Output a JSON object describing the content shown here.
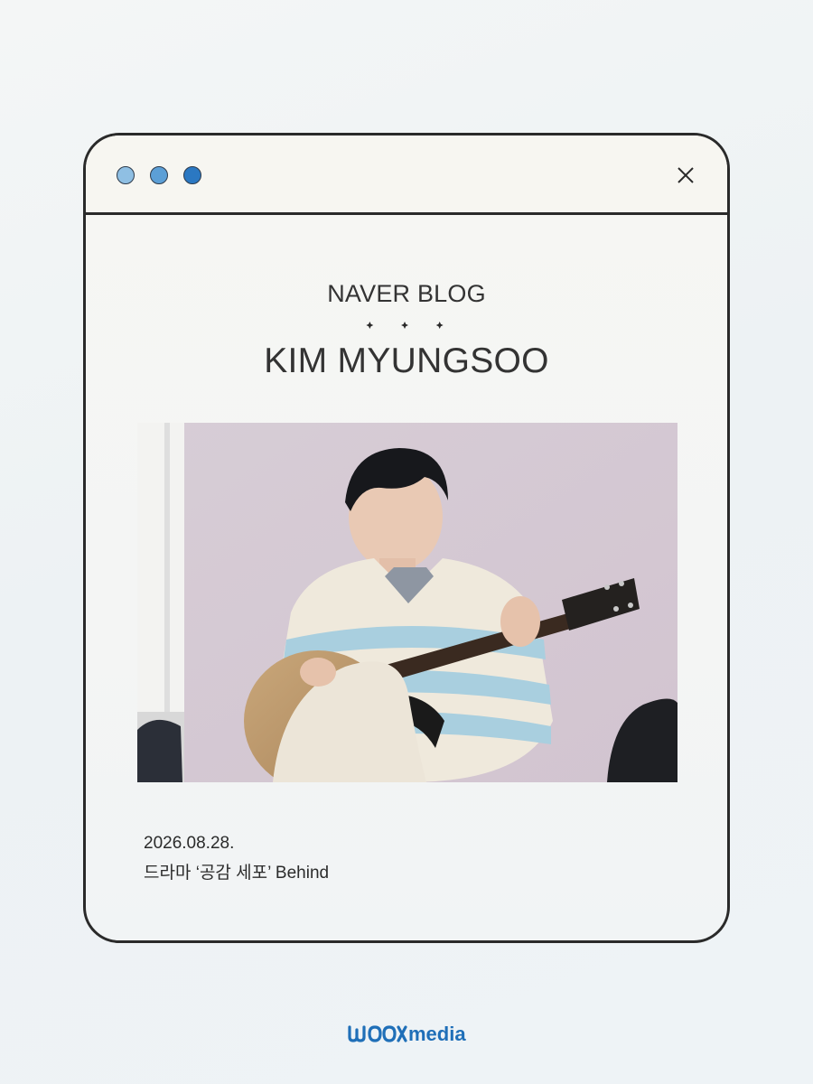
{
  "window": {
    "controls": [
      {
        "name": "dot-light-blue",
        "color": "#8fbfe3"
      },
      {
        "name": "dot-mid-blue",
        "color": "#5c9fd6"
      },
      {
        "name": "dot-dark-blue",
        "color": "#2b78c2"
      }
    ],
    "close_icon": "close-icon"
  },
  "header": {
    "blog_label": "NAVER BLOG",
    "separator_icon": "sparkle-star-icon",
    "artist_name": "KIM MYUNGSOO"
  },
  "photo": {
    "subject": "man-playing-acoustic-guitar"
  },
  "post": {
    "date": "2026.08.28.",
    "caption": "드라마 ‘공감 세포’ Behind"
  },
  "footer": {
    "logo_text": "woolimedia",
    "brand_color": "#1f6fb8"
  },
  "colors": {
    "border": "#2a2a2a",
    "text": "#333333",
    "accent": "#2b78c2"
  }
}
